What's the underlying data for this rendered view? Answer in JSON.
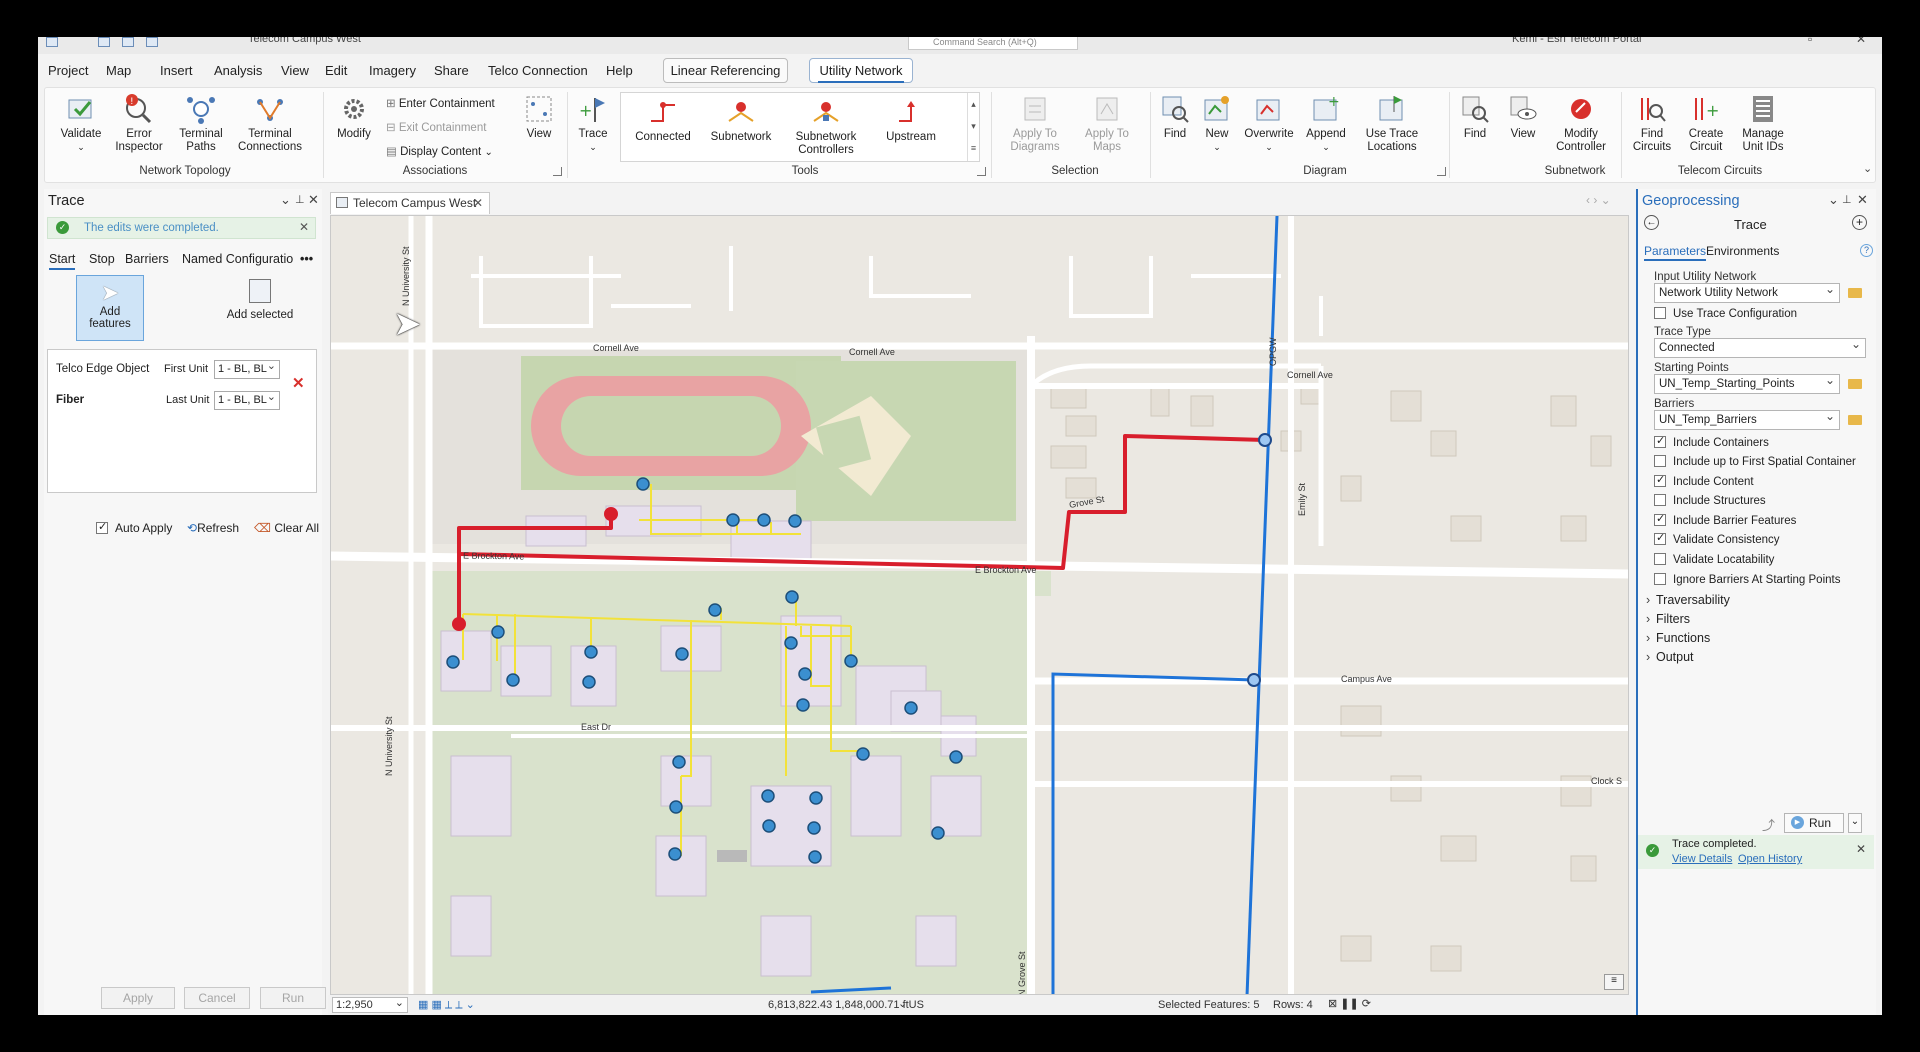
{
  "titlebar": {
    "project_title": "Telecom Campus West",
    "command_search_placeholder": "Command Search (Alt+Q)",
    "portal": "Kemi - Esri Telecom Portal"
  },
  "menu": {
    "items": [
      "Project",
      "Map",
      "Insert",
      "Analysis",
      "View",
      "Edit",
      "Imagery",
      "Share",
      "Telco Connection",
      "Help"
    ],
    "ctx_linear": "Linear Referencing",
    "ctx_utility": "Utility Network"
  },
  "ribbon": {
    "validate": "Validate",
    "error_inspector": "Error Inspector",
    "terminal_paths": "Terminal Paths",
    "terminal_connections": "Terminal Connections",
    "group_topology": "Network Topology",
    "modify": "Modify",
    "enter_containment": "Enter Containment",
    "exit_containment": "Exit Containment",
    "display_content": "Display Content",
    "view": "View",
    "group_associations": "Associations",
    "trace": "Trace",
    "connected": "Connected",
    "subnetwork": "Subnetwork",
    "subnetwork_controllers": "Subnetwork Controllers",
    "upstream": "Upstream",
    "group_tools": "Tools",
    "apply_to_diagrams": "Apply To Diagrams",
    "apply_to_maps": "Apply To Maps",
    "group_selection": "Selection",
    "find": "Find",
    "new": "New",
    "overwrite": "Overwrite",
    "append": "Append",
    "use_trace_locations": "Use Trace Locations",
    "group_diagram": "Diagram",
    "sub_find": "Find",
    "sub_view": "View",
    "modify_controller": "Modify Controller",
    "group_subnetwork": "Subnetwork",
    "find_circuits": "Find Circuits",
    "create_circuit": "Create Circuit",
    "manage_unit_ids": "Manage Unit IDs",
    "group_circuits": "Telecom Circuits"
  },
  "trace_pane": {
    "title": "Trace",
    "message": "The edits were completed.",
    "tabs": [
      "Start",
      "Stop",
      "Barriers",
      "Named Configuratio"
    ],
    "add_features": "Add features",
    "add_selected": "Add selected",
    "feature_class": "Telco Edge Object",
    "feature_name": "Fiber",
    "first_unit_label": "First Unit",
    "first_unit_value": "1 - BL, BL",
    "last_unit_label": "Last Unit",
    "last_unit_value": "1 - BL, BL",
    "auto_apply": "Auto Apply",
    "refresh": "Refresh",
    "clear_all": "Clear All",
    "apply": "Apply",
    "cancel": "Cancel",
    "run": "Run"
  },
  "map_pane": {
    "tab_title": "Telecom Campus West",
    "streets": {
      "cornell_w": "Cornell Ave",
      "cornell_m": "Cornell Ave",
      "cornell_e": "Cornell Ave",
      "brockton_w": "E Brockton Ave",
      "brockton_e": "E Brockton Ave",
      "grove": "Grove St",
      "east_dr": "East Dr",
      "campus": "Campus Ave",
      "clock": "Clock S",
      "n_university_1": "N University St",
      "n_university_2": "N University St",
      "n_grove": "N Grove St",
      "emily": "Emily St",
      "opgw": "OPGW"
    },
    "scale": "1:2,950",
    "coordinates": "6,813,822.43 1,848,000.71 ftUS",
    "selected_features": "Selected Features: 5",
    "rows": "Rows: 4"
  },
  "gp_pane": {
    "title": "Geoprocessing",
    "tool": "Trace",
    "tab_parameters": "Parameters",
    "tab_environments": "Environments",
    "input_network_label": "Input Utility Network",
    "input_network_value": "Network Utility Network",
    "use_trace_config": "Use Trace Configuration",
    "trace_type_label": "Trace Type",
    "trace_type_value": "Connected",
    "starting_points_label": "Starting Points",
    "starting_points_value": "UN_Temp_Starting_Points",
    "barriers_label": "Barriers",
    "barriers_value": "UN_Temp_Barriers",
    "checks": [
      {
        "label": "Include Containers",
        "checked": true
      },
      {
        "label": "Include up to First Spatial Container",
        "checked": false
      },
      {
        "label": "Include Content",
        "checked": true
      },
      {
        "label": "Include Structures",
        "checked": false
      },
      {
        "label": "Include Barrier Features",
        "checked": true
      },
      {
        "label": "Validate Consistency",
        "checked": true
      },
      {
        "label": "Validate Locatability",
        "checked": false
      },
      {
        "label": "Ignore Barriers At Starting Points",
        "checked": false
      }
    ],
    "sections": [
      "Traversability",
      "Filters",
      "Functions",
      "Output"
    ],
    "run": "Run",
    "status": "Trace completed.",
    "view_details": "View Details",
    "open_history": "Open History"
  },
  "colors": {
    "accent": "#2a6ebb",
    "trace_red": "#d81e2c",
    "fiber_yellow": "#f2e23a",
    "blue_line": "#1e73d8"
  }
}
